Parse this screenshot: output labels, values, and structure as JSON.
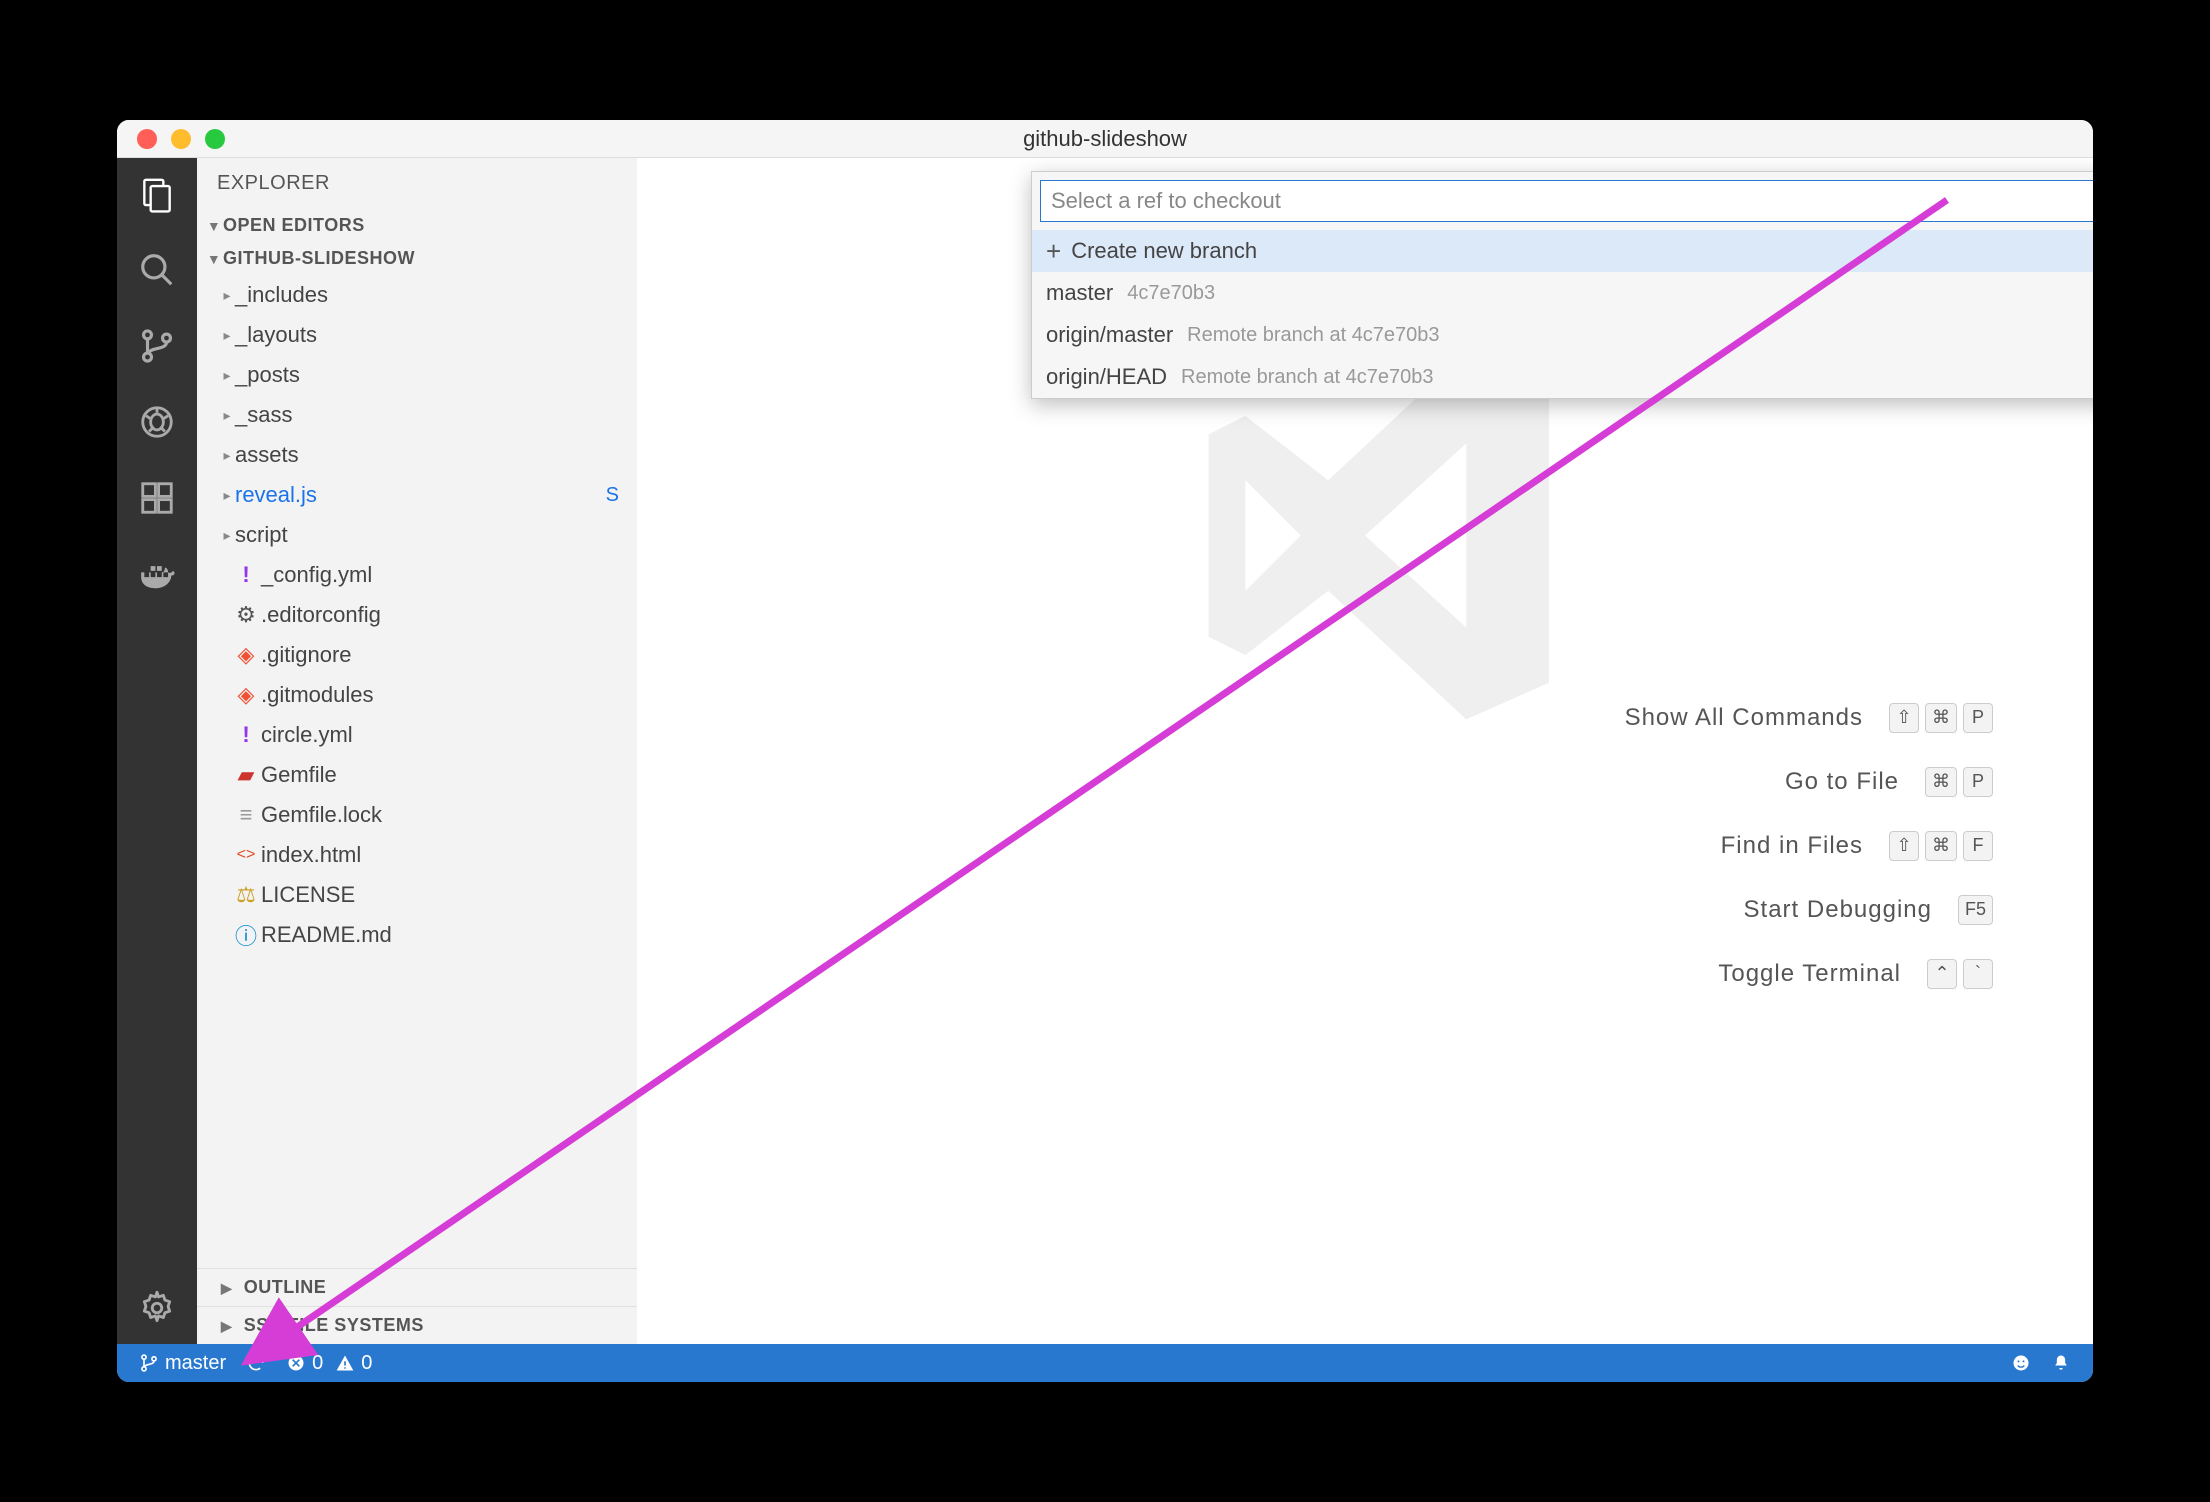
{
  "window": {
    "title": "github-slideshow"
  },
  "sidebar": {
    "title": "EXPLORER",
    "sections": {
      "open_editors": "OPEN EDITORS",
      "project": "GITHUB-SLIDESHOW",
      "outline": "OUTLINE",
      "ssh": "SSH FILE SYSTEMS"
    },
    "files": [
      {
        "name": "_includes",
        "kind": "folder"
      },
      {
        "name": "_layouts",
        "kind": "folder"
      },
      {
        "name": "_posts",
        "kind": "folder"
      },
      {
        "name": "_sass",
        "kind": "folder"
      },
      {
        "name": "assets",
        "kind": "folder"
      },
      {
        "name": "reveal.js",
        "kind": "folder",
        "modified": true,
        "badge": "S"
      },
      {
        "name": "script",
        "kind": "folder"
      },
      {
        "name": "_config.yml",
        "kind": "file",
        "icon": "yaml"
      },
      {
        "name": ".editorconfig",
        "kind": "file",
        "icon": "gear"
      },
      {
        "name": ".gitignore",
        "kind": "file",
        "icon": "git"
      },
      {
        "name": ".gitmodules",
        "kind": "file",
        "icon": "git"
      },
      {
        "name": "circle.yml",
        "kind": "file",
        "icon": "yaml"
      },
      {
        "name": "Gemfile",
        "kind": "file",
        "icon": "ruby"
      },
      {
        "name": "Gemfile.lock",
        "kind": "file",
        "icon": "txt"
      },
      {
        "name": "index.html",
        "kind": "file",
        "icon": "html"
      },
      {
        "name": "LICENSE",
        "kind": "file",
        "icon": "license"
      },
      {
        "name": "README.md",
        "kind": "file",
        "icon": "info"
      }
    ]
  },
  "quickpick": {
    "placeholder": "Select a ref to checkout",
    "items": [
      {
        "label": "Create new branch",
        "plus": true
      },
      {
        "label": "master",
        "desc": "4c7e70b3"
      },
      {
        "label": "origin/master",
        "desc": "Remote branch at 4c7e70b3"
      },
      {
        "label": "origin/HEAD",
        "desc": "Remote branch at 4c7e70b3"
      }
    ]
  },
  "welcome": {
    "rows": [
      {
        "label": "Show All Commands",
        "keys": [
          "⇧",
          "⌘",
          "P"
        ]
      },
      {
        "label": "Go to File",
        "keys": [
          "⌘",
          "P"
        ]
      },
      {
        "label": "Find in Files",
        "keys": [
          "⇧",
          "⌘",
          "F"
        ]
      },
      {
        "label": "Start Debugging",
        "keys": [
          "F5"
        ]
      },
      {
        "label": "Toggle Terminal",
        "keys": [
          "⌃",
          "`"
        ]
      }
    ]
  },
  "status": {
    "branch": "master",
    "errors": "0",
    "warnings": "0"
  }
}
